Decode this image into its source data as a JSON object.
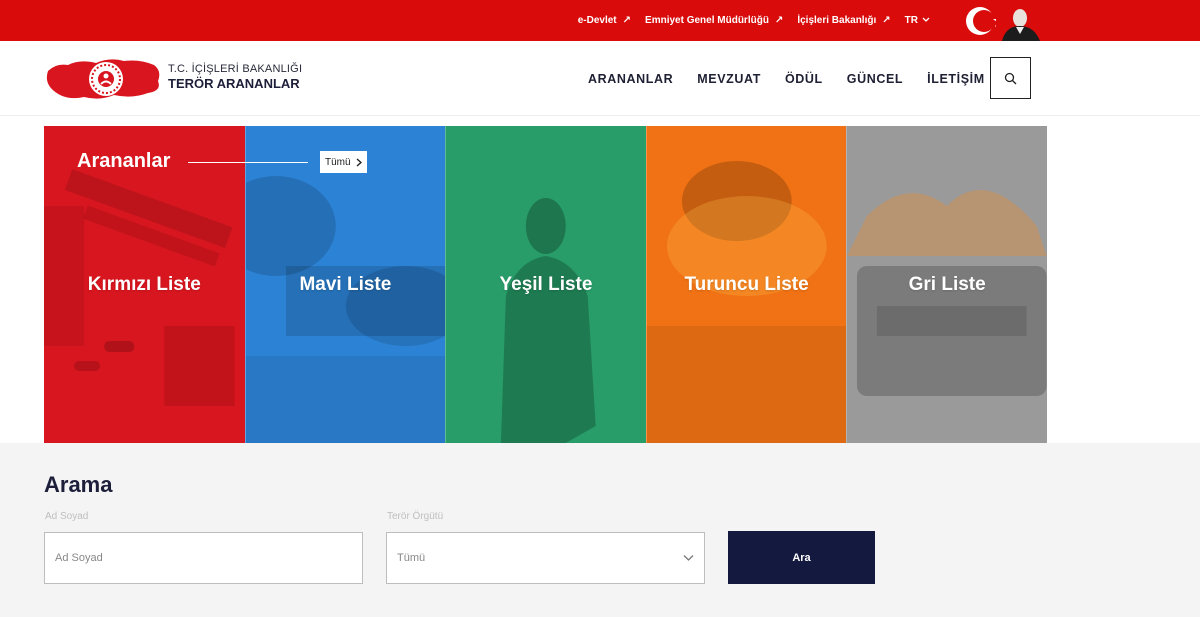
{
  "topbar": {
    "links": [
      {
        "label": "e-Devlet"
      },
      {
        "label": "Emniyet Genel Müdürlüğü"
      },
      {
        "label": "İçişleri Bakanlığı"
      }
    ],
    "language": "TR",
    "color": "#d90b0b"
  },
  "header": {
    "logo_line1": "T.C. İÇİŞLERİ BAKANLIĞI",
    "logo_line2": "TERÖR ARANANLAR",
    "nav": [
      "ARANANLAR",
      "MEVZUAT",
      "ÖDÜL",
      "GÜNCEL",
      "İLETİŞİM"
    ],
    "search_icon": "search-icon"
  },
  "wanted": {
    "title": "Arananlar",
    "all_button": "Tümü",
    "lists": [
      {
        "label": "Kırmızı Liste",
        "color": "#d8161f"
      },
      {
        "label": "Mavi Liste",
        "color": "#2c83d6"
      },
      {
        "label": "Yeşil Liste",
        "color": "#2aa46e"
      },
      {
        "label": "Turuncu Liste",
        "color": "#f07214"
      },
      {
        "label": "Gri Liste",
        "color": "#9a9a9a"
      }
    ]
  },
  "search": {
    "title": "Arama",
    "name_label": "Ad Soyad",
    "name_placeholder": "Ad Soyad",
    "org_label": "Terör Örgütü",
    "org_selected": "Tümü",
    "submit_label": "Ara",
    "submit_color": "#141a3f"
  }
}
